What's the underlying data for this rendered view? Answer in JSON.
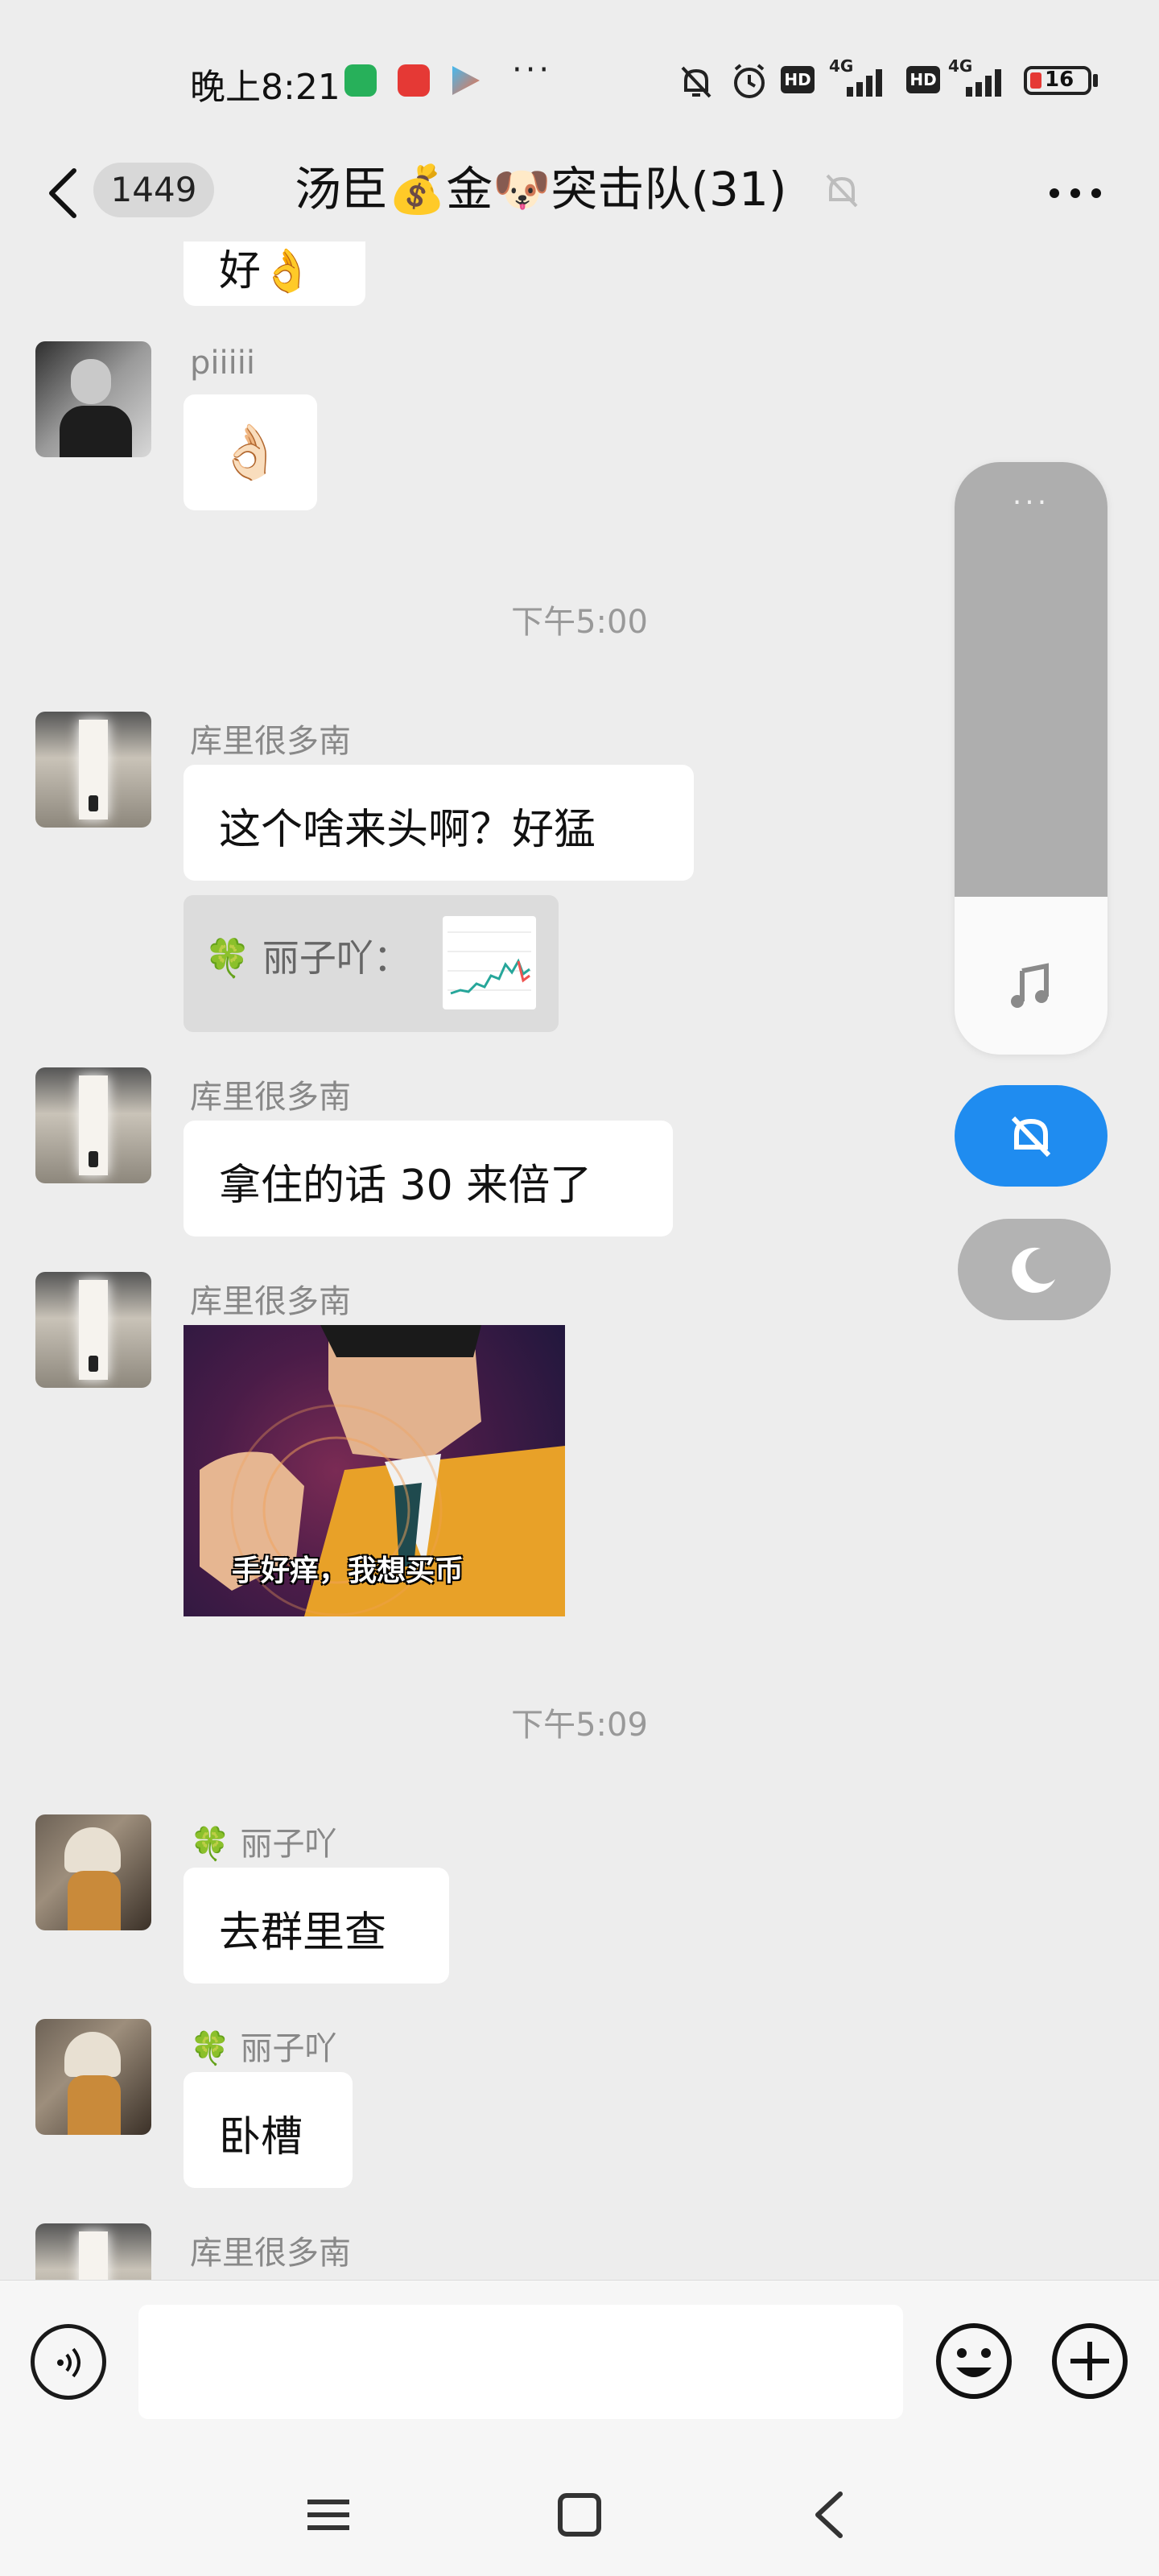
{
  "status_bar": {
    "time": "晚上8:21",
    "more_dots": "···",
    "network_1": "4G",
    "network_2": "4G",
    "hd_1": "HD",
    "hd_2": "HD",
    "battery": "16",
    "battery_color": "#e53935"
  },
  "header": {
    "unread_count": "1449",
    "title": "汤臣💰金🐶突击队(31)",
    "back_icon": "chevron-left-icon",
    "mute_icon": "bell-off-icon",
    "more_icon": "more-dots-icon"
  },
  "messages": [
    {
      "type": "text",
      "text": "好👌"
    },
    {
      "type": "sticker",
      "sender": "piiiii",
      "text": "👌🏻"
    },
    {
      "type": "timestamp",
      "text": "下午5:00"
    },
    {
      "type": "text",
      "sender": "库里很多南",
      "text": "这个啥来头啊？好猛"
    },
    {
      "type": "quote",
      "text": "🍀 丽子吖："
    },
    {
      "type": "text",
      "sender": "库里很多南",
      "text": "拿住的话 30 来倍了"
    },
    {
      "type": "image",
      "sender": "库里很多南",
      "caption": "手好痒，我想买币"
    },
    {
      "type": "timestamp",
      "text": "下午5:09"
    },
    {
      "type": "text",
      "sender": "🍀 丽子吖",
      "text": "去群里查"
    },
    {
      "type": "text",
      "sender": "🍀 丽子吖",
      "text": "卧槽"
    },
    {
      "type": "partial",
      "sender": "库里很多南"
    }
  ],
  "floating_panel": {
    "dots": "···",
    "music_icon": "music-note-icon",
    "mute_icon": "bell-off-icon",
    "dnd_icon": "moon-icon",
    "accent": "#1f8cf0"
  },
  "input_bar": {
    "placeholder": "",
    "voice_icon": "voice-icon",
    "emoji_icon": "emoji-icon",
    "plus_icon": "plus-circle-icon"
  },
  "nav_bar": {
    "menu_icon": "menu-icon",
    "home_icon": "home-square-icon",
    "back_icon": "back-triangle-icon"
  }
}
